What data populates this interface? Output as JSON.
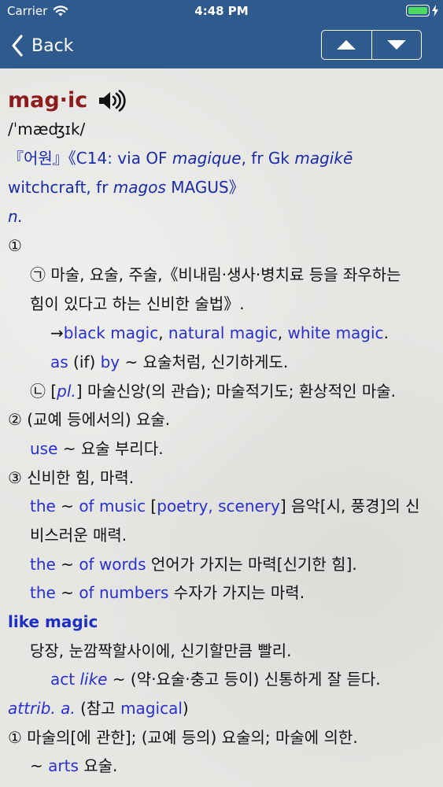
{
  "status": {
    "carrier": "Carrier",
    "time": "4:48 PM"
  },
  "nav": {
    "back_label": "Back"
  },
  "entry": {
    "headword": "mag·ic",
    "pronunciation": "/ˈmæʤɪk/",
    "etym": {
      "lead": "『어원』《C14: via OF ",
      "w1": "magique",
      "mid": ", fr Gk ",
      "w2": "magikē",
      "line2a": "witchcraft, fr ",
      "w3": "magos",
      "line2b": " MAGUS》"
    },
    "pos": "n.",
    "sense1_num": "①",
    "s1a_line1": "㉠ 마술, 요술, 주술,《비내림·생사·병치료 등을 좌우하는",
    "s1a_line2": "힘이 있다고 하는 신비한 술법》.",
    "s1a_cross": {
      "arrow": "→",
      "t1": "black magic",
      "c1": ", ",
      "t2": "natural magic",
      "c2": ", ",
      "t3": "white magic",
      "end": "."
    },
    "s1a_ex": {
      "p1": "as ",
      "p2": "(if)",
      "p3": " by",
      "rest": " ~ 요술처럼, 신기하게도."
    },
    "s1b": {
      "lead": "㉡ [",
      "pl": "pl.",
      "rest": "] 마술신앙(의 관습); 마술적기도; 환상적인 마술."
    },
    "s2": "② (교예 등에서의) 요술.",
    "s2_ex": {
      "w": "use",
      "rest": " ~ 요술 부리다."
    },
    "s3": "③ 신비한 힘, 마력.",
    "s3_ex1": {
      "a": "the",
      "b": " ~ ",
      "c": "of music",
      "d": " [",
      "e": "poetry, scenery",
      "f": "] 음악[시, 풍경]의 신"
    },
    "s3_ex1b": "비스러운 매력.",
    "s3_ex2": {
      "a": "the",
      "b": " ~ ",
      "c": "of words",
      "rest": " 언어가 가지는 마력[신기한 힘]."
    },
    "s3_ex3": {
      "a": "the",
      "b": " ~ ",
      "c": "of numbers",
      "rest": " 수자가 가지는 마력."
    },
    "idiom": "like magic",
    "idiom_def": "당장, 눈깜짝할사이에, 신기할만큼 빨리.",
    "idiom_ex": {
      "w1": "act",
      "w2": "like",
      "rest": " ~ (약·요술·충고 등이) 신통하게 잘 듣다."
    },
    "attrib": {
      "a": "attrib. a.",
      "b": " (참고 ",
      "c": "magical",
      "d": ")"
    },
    "a1": "① 마술의[에 관한]; (교예 등의) 요술의; 마술에 의한.",
    "a1_ex": {
      "a": "~ ",
      "b": "arts",
      "c": " 요술."
    }
  }
}
